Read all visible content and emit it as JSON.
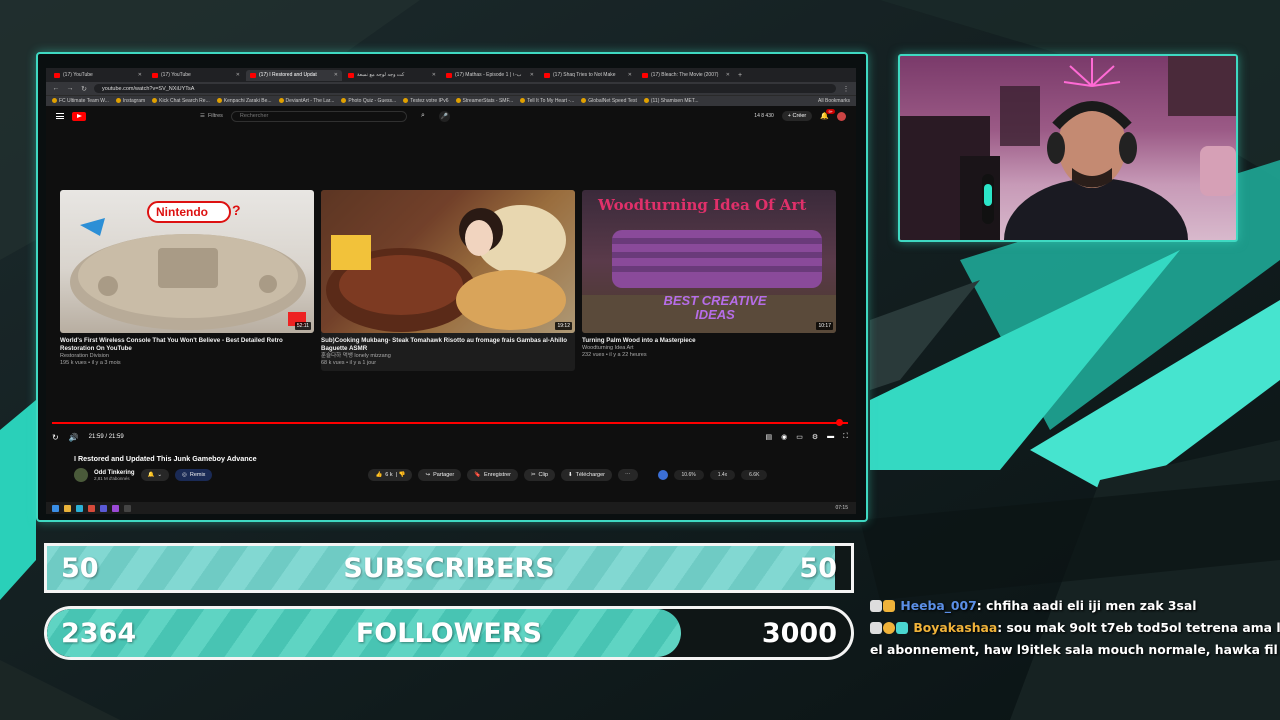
{
  "browser": {
    "tabs": [
      {
        "label": "(17) YouTube",
        "active": false
      },
      {
        "label": "(17) YouTube",
        "active": false
      },
      {
        "label": "(17) I Restored and Updat",
        "active": true
      },
      {
        "label": "كت وجه لوجه مع نسعة",
        "active": false
      },
      {
        "label": "(17) Mathas - Episode 1 | ۱-ب",
        "active": false
      },
      {
        "label": "(17) Shaq Tries to Not Make",
        "active": false
      },
      {
        "label": "(17) Bleach: The Movie (2007)",
        "active": false
      }
    ],
    "url": "youtube.com/watch?v=SV_NXiUYTsA",
    "bookmarks": [
      "FC Ultimate Team W...",
      "Instagram",
      "Kick Chat Search Re...",
      "Kenpachi Zaraki Be...",
      "DeviantArt - The Lar...",
      "Photo Quiz - Guess...",
      "Testez votre IPv6",
      "StreamerStats - SMF...",
      "Tell It To My Heart -...",
      "GlobalNet Speed Test",
      "(11) Shamisen MET..."
    ],
    "all_bookmarks": "All Bookmarks"
  },
  "youtube": {
    "filters_label": "Filtres",
    "search_placeholder": "Rechercher",
    "header_stats": "14   8   430",
    "create_label": "Créer",
    "notif_count": "9+",
    "videos": [
      {
        "title": "World's First Wireless Console That You Won't Believe - Best Detailed Retro Restoration On YouTube",
        "channel": "Restoration Division",
        "meta": "195 k vues • il y a 3 mois",
        "duration": "52:11"
      },
      {
        "title": "Sub)Cooking Mukbang- Steak Tomahawk Risotto au fromage frais Gambas al-Ahillo Baguette ASMR",
        "channel": "훈슐다하 먹뱅 lonely mizzang",
        "meta": "68 k vues • il y a 1 jour",
        "duration": "19:12"
      },
      {
        "title": "Turning Palm Wood into a Masterpiece",
        "channel": "Woodturning Idea Art",
        "meta": "232 vues • il y a 22 heures",
        "duration": "10:17"
      }
    ],
    "thumb_text": {
      "nintendo": "Nintendo",
      "wood_title": "Woodturning Idea Of Art",
      "wood_sub": "BEST CREATIVE IDEAS"
    },
    "time": "21:59 / 21:59",
    "watch_title": "I Restored and Updated This Junk Gameboy Advance",
    "channel_name": "Odd Tinkering",
    "channel_subs": "2,81 M d'abonnés",
    "remix_label": "Remix",
    "likes": "6 k",
    "share_label": "Partager",
    "save_label": "Enregistrer",
    "clip_label": "Clip",
    "download_label": "Télécharger",
    "stats": [
      "10.6%",
      "1.4x",
      "6.6K"
    ],
    "clock": "07:15"
  },
  "goals": {
    "subscribers": {
      "current": "50",
      "label": "SUBSCRIBERS",
      "target": "50",
      "progress": 1.0
    },
    "followers": {
      "current": "2364",
      "label": "FOLLOWERS",
      "target": "3000",
      "progress": 0.788
    }
  },
  "chat": [
    {
      "user": "Heeba_007",
      "message": ": chfiha aadi eli iji men zak 3sal",
      "color": "#5b8fe6"
    },
    {
      "user": "Boyakashaa",
      "message": ": sou mak 9olt t7eb tod5ol tetrena ama lezm chk",
      "color": "#f0b33a"
    },
    {
      "user": "",
      "message": "el abonnement, haw l9itlek sala mouch normale, hawka fil react to th",
      "color": "#ffffff"
    }
  ]
}
